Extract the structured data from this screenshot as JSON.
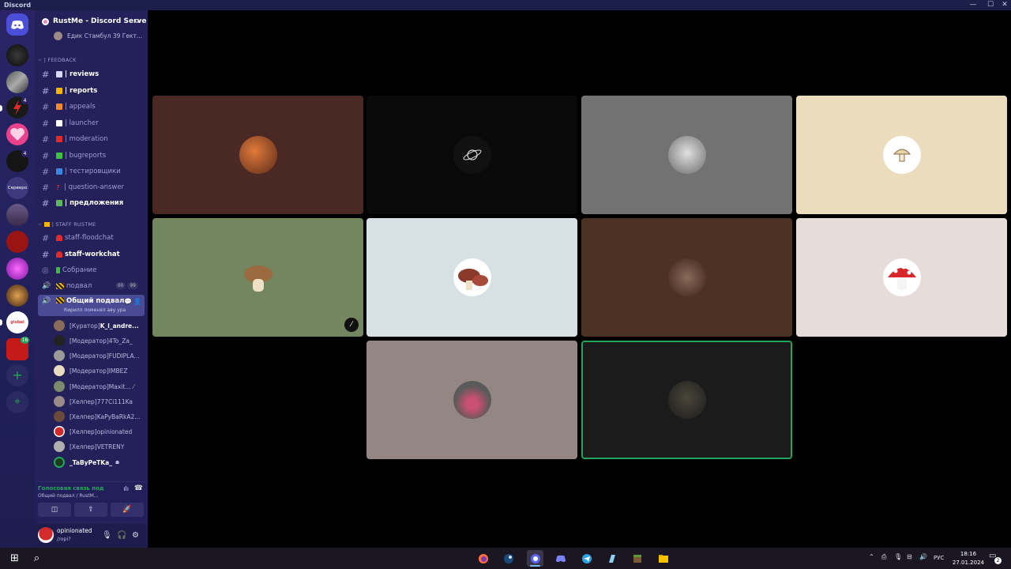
{
  "titlebar": {
    "app_name": "Discord",
    "minimize": "—",
    "maximize": "☐",
    "close": "✕"
  },
  "server": {
    "name": "RustMe - Discord Serve",
    "chevron": "⌵"
  },
  "rail": {
    "servers_label": "Серверо",
    "global_label": "global",
    "badge_a": "4",
    "badge_b": "16",
    "add_icon": "+",
    "explore_icon": "⌖"
  },
  "sidebar": {
    "top_member": "Едик Стамбул 39 Гект...",
    "category_feedback": "| FEEDBACK",
    "channels": [
      {
        "name": "| reviews",
        "unread": true,
        "color": "#d9d9ff"
      },
      {
        "name": "| reports",
        "unread": true,
        "color": "#f5b400"
      },
      {
        "name": "| appeals",
        "unread": false,
        "color": "#f58a2a"
      },
      {
        "name": "| launcher",
        "unread": false,
        "color": "#ffffff"
      },
      {
        "name": "| moderation",
        "unread": false,
        "color": "#e02b2b"
      },
      {
        "name": "| bugreports",
        "unread": false,
        "color": "#3bc13b"
      },
      {
        "name": "| тестировщики",
        "unread": false,
        "color": "#3a86e0"
      },
      {
        "name": "| question-answer",
        "unread": false,
        "color": "#ff3b3b",
        "glyph": "?"
      },
      {
        "name": "| предложения",
        "unread": true,
        "color": "#5fb85f"
      }
    ],
    "category_staff": "| STAFF RUSTME",
    "staff_channels": [
      {
        "name": "staff-floodchat",
        "unread": false
      },
      {
        "name": "staff-workchat",
        "unread": true
      },
      {
        "name": "Собрание",
        "unread": false
      }
    ],
    "voice_basement": {
      "name": "подвал",
      "count_a": "00",
      "count_b": "99"
    },
    "active_channel": {
      "name": "Общий подвал",
      "subtitle": "Кирилл поменял аву ура"
    },
    "members": [
      {
        "prefix": "[Куратор] ",
        "name": "K_l_andre...",
        "bold": true,
        "color": "#8a6a5a"
      },
      {
        "prefix": "[Модератор] ",
        "name": "4To_Za_",
        "bold": false,
        "color": "#222222"
      },
      {
        "prefix": "[Модератор] ",
        "name": "FUDIPLA...",
        "bold": false,
        "color": "#9a9a9a"
      },
      {
        "prefix": "[Модератор] ",
        "name": "IMBEZ",
        "bold": false,
        "color": "#e8dcc0"
      },
      {
        "prefix": "[Модератор] ",
        "name": "Maxit...",
        "bold": false,
        "color": "#7a8a6a"
      },
      {
        "prefix": "[Хелпер] ",
        "name": "777Ci111Ka",
        "bold": false,
        "color": "#9a8a88"
      },
      {
        "prefix": "[Хелпер] ",
        "name": "KaPyBaRkA2...",
        "bold": false,
        "color": "#6b4a3a"
      },
      {
        "prefix": "[Хелпер] ",
        "name": "opinionated",
        "bold": false,
        "color": "#d32b2b"
      },
      {
        "prefix": "[Хелпер] ",
        "name": "VETRENY",
        "bold": false,
        "color": "#b0b0b0"
      },
      {
        "prefix": "",
        "name": "_TaByPeTKa_",
        "bold": true,
        "color": "#1e3a1e"
      }
    ]
  },
  "voice_status": {
    "title": "Голосовая связь под",
    "subtitle": "Общий подвал / RustM...",
    "btn_camera": "◫",
    "btn_share": "⇪",
    "btn_activity": "🚀"
  },
  "user": {
    "name": "opinionated",
    "status": "//opi?",
    "mic": "🎙",
    "headset": "🎧",
    "settings": "⚙"
  },
  "grid_tiles": [
    {
      "bg": "#4a2824",
      "avatar": "#c0553a"
    },
    {
      "bg": "#090909",
      "avatar": "#111111"
    },
    {
      "bg": "#727272",
      "avatar": "#c8c8c8"
    },
    {
      "bg": "#eadcbc",
      "avatar": "#f5ecd8"
    },
    {
      "bg": "#748660",
      "avatar": "#9b6a3e"
    },
    {
      "bg": "#d7e1e3",
      "avatar": "#8a4a3a"
    },
    {
      "bg": "#4b3224",
      "avatar": "#7a5a4a"
    },
    {
      "bg": "#e6dcda",
      "avatar": "#d8262b"
    },
    {
      "bg": "#938683",
      "avatar": "#6a6a6a"
    },
    {
      "bg": "#1b1b1b",
      "avatar": "#2b2a22"
    }
  ],
  "taskbar": {
    "start": "⊞",
    "search": "⌕",
    "lang": "РУС",
    "time": "18:16",
    "date": "27.01.2024",
    "notif": "2"
  }
}
